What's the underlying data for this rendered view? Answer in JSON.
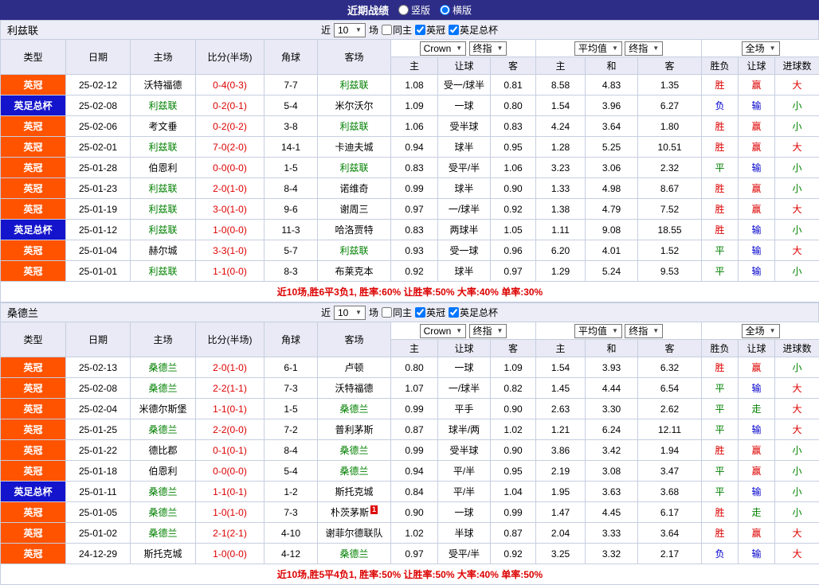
{
  "topbar": {
    "title": "近期战绩",
    "vertical_label": "竖版",
    "horizontal_label": "横版",
    "selected_layout": "横版"
  },
  "filter": {
    "near": "近",
    "count": "10",
    "games": "场",
    "same_home": "同主",
    "league": "英冠",
    "cup": "英足总杯",
    "same_home_checked": false,
    "league_checked": true,
    "cup_checked": true
  },
  "dropdowns": {
    "bookmaker": "Crown",
    "final1": "终指",
    "average": "平均值",
    "final2": "终指",
    "scope": "全场"
  },
  "columns": {
    "main": [
      "类型",
      "日期",
      "主场",
      "比分(半场)",
      "角球",
      "客场"
    ],
    "sub": [
      "主",
      "让球",
      "客",
      "主",
      "和",
      "客",
      "胜负",
      "让球",
      "进球数"
    ]
  },
  "legend_colors": {
    "league_badge": "#ff5300",
    "cup_badge": "#1414cc",
    "win_red": "#dd0000",
    "draw_green": "#008000",
    "loss_blue": "#0000cc",
    "team_highlight": "#008000",
    "topbar_bg": "#2d2d87"
  },
  "sections": [
    {
      "team": "利兹联",
      "rows": [
        {
          "type": "英冠",
          "date": "25-02-12",
          "home": "沃特福德",
          "score": "0-4(0-3)",
          "corners": "7-7",
          "away": "利兹联",
          "odds_home": "1.08",
          "handicap": "受一/球半",
          "odds_away": "0.81",
          "avg_home": "8.58",
          "avg_draw": "4.83",
          "avg_away": "1.35",
          "result": "胜",
          "handicap_result": "赢",
          "goals": "大"
        },
        {
          "type": "英足总杯",
          "date": "25-02-08",
          "home": "利兹联",
          "score": "0-2(0-1)",
          "corners": "5-4",
          "away": "米尔沃尔",
          "odds_home": "1.09",
          "handicap": "一球",
          "odds_away": "0.80",
          "avg_home": "1.54",
          "avg_draw": "3.96",
          "avg_away": "6.27",
          "result": "负",
          "handicap_result": "输",
          "goals": "小"
        },
        {
          "type": "英冠",
          "date": "25-02-06",
          "home": "考文垂",
          "score": "0-2(0-2)",
          "corners": "3-8",
          "away": "利兹联",
          "odds_home": "1.06",
          "handicap": "受半球",
          "odds_away": "0.83",
          "avg_home": "4.24",
          "avg_draw": "3.64",
          "avg_away": "1.80",
          "result": "胜",
          "handicap_result": "赢",
          "goals": "小"
        },
        {
          "type": "英冠",
          "date": "25-02-01",
          "home": "利兹联",
          "score": "7-0(2-0)",
          "corners": "14-1",
          "away": "卡迪夫城",
          "odds_home": "0.94",
          "handicap": "球半",
          "odds_away": "0.95",
          "avg_home": "1.28",
          "avg_draw": "5.25",
          "avg_away": "10.51",
          "result": "胜",
          "handicap_result": "赢",
          "goals": "大"
        },
        {
          "type": "英冠",
          "date": "25-01-28",
          "home": "伯恩利",
          "score": "0-0(0-0)",
          "corners": "1-5",
          "away": "利兹联",
          "odds_home": "0.83",
          "handicap": "受平/半",
          "odds_away": "1.06",
          "avg_home": "3.23",
          "avg_draw": "3.06",
          "avg_away": "2.32",
          "result": "平",
          "handicap_result": "输",
          "goals": "小"
        },
        {
          "type": "英冠",
          "date": "25-01-23",
          "home": "利兹联",
          "score": "2-0(1-0)",
          "corners": "8-4",
          "away": "诺维奇",
          "odds_home": "0.99",
          "handicap": "球半",
          "odds_away": "0.90",
          "avg_home": "1.33",
          "avg_draw": "4.98",
          "avg_away": "8.67",
          "result": "胜",
          "handicap_result": "赢",
          "goals": "小"
        },
        {
          "type": "英冠",
          "date": "25-01-19",
          "home": "利兹联",
          "score": "3-0(1-0)",
          "corners": "9-6",
          "away": "谢周三",
          "odds_home": "0.97",
          "handicap": "一/球半",
          "odds_away": "0.92",
          "avg_home": "1.38",
          "avg_draw": "4.79",
          "avg_away": "7.52",
          "result": "胜",
          "handicap_result": "赢",
          "goals": "大"
        },
        {
          "type": "英足总杯",
          "date": "25-01-12",
          "home": "利兹联",
          "score": "1-0(0-0)",
          "corners": "11-3",
          "away": "哈洛贾特",
          "odds_home": "0.83",
          "handicap": "两球半",
          "odds_away": "1.05",
          "avg_home": "1.11",
          "avg_draw": "9.08",
          "avg_away": "18.55",
          "result": "胜",
          "handicap_result": "输",
          "goals": "小"
        },
        {
          "type": "英冠",
          "date": "25-01-04",
          "home": "赫尔城",
          "score": "3-3(1-0)",
          "corners": "5-7",
          "away": "利兹联",
          "odds_home": "0.93",
          "handicap": "受一球",
          "odds_away": "0.96",
          "avg_home": "6.20",
          "avg_draw": "4.01",
          "avg_away": "1.52",
          "result": "平",
          "handicap_result": "输",
          "goals": "大"
        },
        {
          "type": "英冠",
          "date": "25-01-01",
          "home": "利兹联",
          "score": "1-1(0-0)",
          "corners": "8-3",
          "away": "布莱克本",
          "odds_home": "0.92",
          "handicap": "球半",
          "odds_away": "0.97",
          "avg_home": "1.29",
          "avg_draw": "5.24",
          "avg_away": "9.53",
          "result": "平",
          "handicap_result": "输",
          "goals": "小"
        }
      ],
      "summary": "近10场,胜6平3负1, 胜率:60% 让胜率:50% 大率:40% 单率:30%"
    },
    {
      "team": "桑德兰",
      "rows": [
        {
          "type": "英冠",
          "date": "25-02-13",
          "home": "桑德兰",
          "score": "2-0(1-0)",
          "corners": "6-1",
          "away": "卢顿",
          "odds_home": "0.80",
          "handicap": "一球",
          "odds_away": "1.09",
          "avg_home": "1.54",
          "avg_draw": "3.93",
          "avg_away": "6.32",
          "result": "胜",
          "handicap_result": "赢",
          "goals": "小"
        },
        {
          "type": "英冠",
          "date": "25-02-08",
          "home": "桑德兰",
          "score": "2-2(1-1)",
          "corners": "7-3",
          "away": "沃特福德",
          "odds_home": "1.07",
          "handicap": "一/球半",
          "odds_away": "0.82",
          "avg_home": "1.45",
          "avg_draw": "4.44",
          "avg_away": "6.54",
          "result": "平",
          "handicap_result": "输",
          "goals": "大"
        },
        {
          "type": "英冠",
          "date": "25-02-04",
          "home": "米德尔斯堡",
          "score": "1-1(0-1)",
          "corners": "1-5",
          "away": "桑德兰",
          "odds_home": "0.99",
          "handicap": "平手",
          "odds_away": "0.90",
          "avg_home": "2.63",
          "avg_draw": "3.30",
          "avg_away": "2.62",
          "result": "平",
          "handicap_result": "走",
          "goals": "大"
        },
        {
          "type": "英冠",
          "date": "25-01-25",
          "home": "桑德兰",
          "score": "2-2(0-0)",
          "corners": "7-2",
          "away": "普利茅斯",
          "odds_home": "0.87",
          "handicap": "球半/两",
          "odds_away": "1.02",
          "avg_home": "1.21",
          "avg_draw": "6.24",
          "avg_away": "12.11",
          "result": "平",
          "handicap_result": "输",
          "goals": "大"
        },
        {
          "type": "英冠",
          "date": "25-01-22",
          "home": "德比郡",
          "score": "0-1(0-1)",
          "corners": "8-4",
          "away": "桑德兰",
          "odds_home": "0.99",
          "handicap": "受半球",
          "odds_away": "0.90",
          "avg_home": "3.86",
          "avg_draw": "3.42",
          "avg_away": "1.94",
          "result": "胜",
          "handicap_result": "赢",
          "goals": "小"
        },
        {
          "type": "英冠",
          "date": "25-01-18",
          "home": "伯恩利",
          "score": "0-0(0-0)",
          "corners": "5-4",
          "away": "桑德兰",
          "odds_home": "0.94",
          "handicap": "平/半",
          "odds_away": "0.95",
          "avg_home": "2.19",
          "avg_draw": "3.08",
          "avg_away": "3.47",
          "result": "平",
          "handicap_result": "赢",
          "goals": "小"
        },
        {
          "type": "英足总杯",
          "date": "25-01-11",
          "home": "桑德兰",
          "score": "1-1(0-1)",
          "corners": "1-2",
          "away": "斯托克城",
          "odds_home": "0.84",
          "handicap": "平/半",
          "odds_away": "1.04",
          "avg_home": "1.95",
          "avg_draw": "3.63",
          "avg_away": "3.68",
          "result": "平",
          "handicap_result": "输",
          "goals": "小"
        },
        {
          "type": "英冠",
          "date": "25-01-05",
          "home": "桑德兰",
          "score": "1-0(1-0)",
          "corners": "7-3",
          "away": "朴茨茅斯",
          "away_badge": "1",
          "odds_home": "0.90",
          "handicap": "一球",
          "odds_away": "0.99",
          "avg_home": "1.47",
          "avg_draw": "4.45",
          "avg_away": "6.17",
          "result": "胜",
          "handicap_result": "走",
          "goals": "小"
        },
        {
          "type": "英冠",
          "date": "25-01-02",
          "home": "桑德兰",
          "score": "2-1(2-1)",
          "corners": "4-10",
          "away": "谢菲尔德联队",
          "odds_home": "1.02",
          "handicap": "半球",
          "odds_away": "0.87",
          "avg_home": "2.04",
          "avg_draw": "3.33",
          "avg_away": "3.64",
          "result": "胜",
          "handicap_result": "赢",
          "goals": "大"
        },
        {
          "type": "英冠",
          "date": "24-12-29",
          "home": "斯托克城",
          "score": "1-0(0-0)",
          "corners": "4-12",
          "away": "桑德兰",
          "odds_home": "0.97",
          "handicap": "受平/半",
          "odds_away": "0.92",
          "avg_home": "3.25",
          "avg_draw": "3.32",
          "avg_away": "2.17",
          "result": "负",
          "handicap_result": "输",
          "goals": "大"
        }
      ],
      "summary": "近10场,胜5平4负1, 胜率:50% 让胜率:50% 大率:40% 单率:50%"
    }
  ]
}
